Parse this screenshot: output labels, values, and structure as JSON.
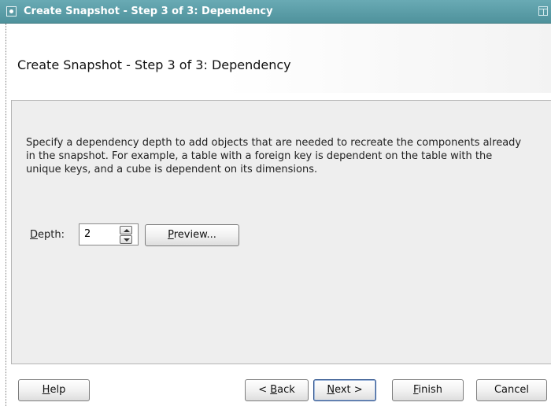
{
  "window": {
    "title": "Create Snapshot - Step 3 of 3: Dependency",
    "menu_icon": "window-menu-icon",
    "maximize_icon": "maximize-icon"
  },
  "header": {
    "title": "Create Snapshot - Step 3 of 3: Dependency"
  },
  "content": {
    "description": "Specify a dependency depth to add objects that are needed to recreate the components already in the snapshot. For example, a table with a foreign key is dependent on the table with the unique keys, and a cube is dependent on its dimensions.",
    "depth_label_mnemonic": "D",
    "depth_label_rest": "epth:",
    "depth_value": "2",
    "preview_mnemonic": "P",
    "preview_rest": "review..."
  },
  "footer": {
    "help_mnemonic": "H",
    "help_rest": "elp",
    "back_prefix": "< ",
    "back_mnemonic": "B",
    "back_rest": "ack",
    "next_mnemonic": "N",
    "next_rest": "ext >",
    "finish_mnemonic": "F",
    "finish_rest": "inish",
    "cancel_label": "Cancel"
  },
  "colors": {
    "titlebar": "#5a9aa4",
    "panel_background": "#eeeeee",
    "default_button_border": "#2a4f8a"
  }
}
